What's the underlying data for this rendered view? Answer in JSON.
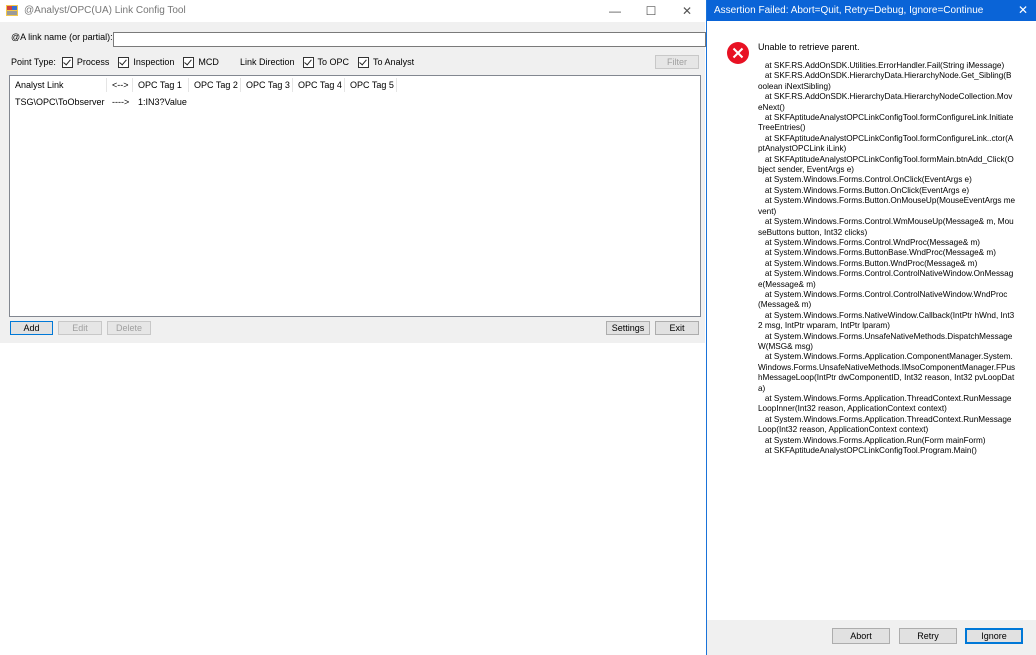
{
  "main_window": {
    "title": "@Analyst/OPC(UA) Link Config Tool",
    "minimize": "—",
    "maximize": "☐",
    "close": "✕",
    "link_name_label": "@A link name (or partial):",
    "link_name_value": "",
    "point_type_label": "Point Type:",
    "point_types": [
      "Process",
      "Inspection",
      "MCD"
    ],
    "link_direction_label": "Link Direction",
    "directions": [
      "To OPC",
      "To Analyst"
    ],
    "filter_button": "Filter",
    "columns": [
      "Analyst Link",
      "",
      "OPC Tag 1",
      "OPC Tag 2",
      "OPC Tag 3",
      "OPC Tag 4",
      "OPC Tag 5"
    ],
    "header_arrow": "<-->",
    "rows": [
      {
        "link": "TSG\\OPC\\ToObserver",
        "dir": "---->",
        "tag1": "1:IN3?Value"
      }
    ],
    "buttons": {
      "add": "Add",
      "edit": "Edit",
      "delete": "Delete",
      "settings": "Settings",
      "exit": "Exit"
    }
  },
  "assert_dialog": {
    "title": "Assertion Failed: Abort=Quit, Retry=Debug, Ignore=Continue",
    "close": "✕",
    "message": "Unable to retrieve parent.",
    "stack_trace": "   at SKF.RS.AddOnSDK.Utilities.ErrorHandler.Fail(String iMessage)\n   at SKF.RS.AddOnSDK.HierarchyData.HierarchyNode.Get_Sibling(Boolean iNextSibling)\n   at SKF.RS.AddOnSDK.HierarchyData.HierarchyNodeCollection.MoveNext()\n   at SKFAptitudeAnalystOPCLinkConfigTool.formConfigureLink.InitiateTreeEntries()\n   at SKFAptitudeAnalystOPCLinkConfigTool.formConfigureLink..ctor(AptAnalystOPCLink iLink)\n   at SKFAptitudeAnalystOPCLinkConfigTool.formMain.btnAdd_Click(Object sender, EventArgs e)\n   at System.Windows.Forms.Control.OnClick(EventArgs e)\n   at System.Windows.Forms.Button.OnClick(EventArgs e)\n   at System.Windows.Forms.Button.OnMouseUp(MouseEventArgs mevent)\n   at System.Windows.Forms.Control.WmMouseUp(Message& m, MouseButtons button, Int32 clicks)\n   at System.Windows.Forms.Control.WndProc(Message& m)\n   at System.Windows.Forms.ButtonBase.WndProc(Message& m)\n   at System.Windows.Forms.Button.WndProc(Message& m)\n   at System.Windows.Forms.Control.ControlNativeWindow.OnMessage(Message& m)\n   at System.Windows.Forms.Control.ControlNativeWindow.WndProc(Message& m)\n   at System.Windows.Forms.NativeWindow.Callback(IntPtr hWnd, Int32 msg, IntPtr wparam, IntPtr lparam)\n   at System.Windows.Forms.UnsafeNativeMethods.DispatchMessageW(MSG& msg)\n   at System.Windows.Forms.Application.ComponentManager.System.Windows.Forms.UnsafeNativeMethods.IMsoComponentManager.FPushMessageLoop(IntPtr dwComponentID, Int32 reason, Int32 pvLoopData)\n   at System.Windows.Forms.Application.ThreadContext.RunMessageLoopInner(Int32 reason, ApplicationContext context)\n   at System.Windows.Forms.Application.ThreadContext.RunMessageLoop(Int32 reason, ApplicationContext context)\n   at System.Windows.Forms.Application.Run(Form mainForm)\n   at SKFAptitudeAnalystOPCLinkConfigTool.Program.Main()",
    "buttons": {
      "abort": "Abort",
      "retry": "Retry",
      "ignore": "Ignore"
    }
  }
}
